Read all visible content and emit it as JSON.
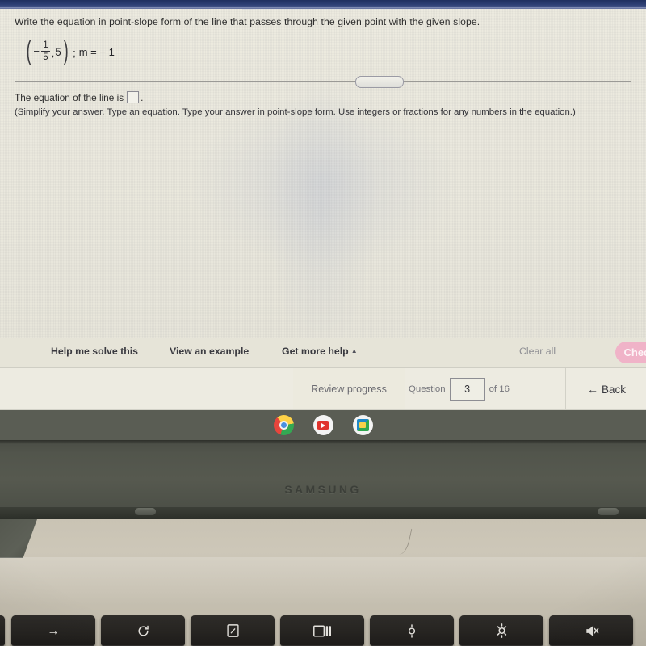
{
  "screen": {
    "problem": {
      "prompt": "Write the equation in point-slope form of the line that passes through the given point with the given slope.",
      "expression": {
        "x_sign": "−",
        "x_num": "1",
        "x_den": "5",
        "separator": ",",
        "y_value": "5",
        "semicolon": ";",
        "slope": "m = − 1"
      },
      "answer_line": "The equation of the line is",
      "answer_suffix": ".",
      "instruction": "(Simplify your answer. Type an equation. Type your answer in point-slope form. Use integers or fractions for any numbers in the equation.)"
    },
    "help_row": {
      "help_me_solve": "Help me solve this",
      "view_example": "View an example",
      "get_more_help": "Get more help",
      "get_more_help_caret": "▲",
      "clear_all": "Clear all",
      "check_button": "Check"
    },
    "nav_bar": {
      "review_progress": "Review progress",
      "question_label": "Question",
      "question_value": "3",
      "question_of": "of 16",
      "back_arrow": "←",
      "back_label": "Back"
    },
    "shelf": {
      "apps": [
        {
          "name": "chrome-icon",
          "label": "Chrome"
        },
        {
          "name": "youtube-icon",
          "label": "YouTube"
        },
        {
          "name": "classroom-icon",
          "label": "Google Classroom"
        }
      ]
    }
  },
  "laptop": {
    "brand": "SAMSUNG",
    "keys": [
      {
        "name": "forward-key",
        "glyph": "→",
        "label": "Forward"
      },
      {
        "name": "reload-key",
        "glyph": "⟳",
        "label": "Reload"
      },
      {
        "name": "fullscreen-key",
        "glyph": "",
        "label": "Fullscreen"
      },
      {
        "name": "overview-key",
        "glyph": "",
        "label": "Show windows"
      },
      {
        "name": "brightness-down-key",
        "glyph": "",
        "label": "Brightness down"
      },
      {
        "name": "brightness-up-key",
        "glyph": "",
        "label": "Brightness up"
      },
      {
        "name": "mute-key",
        "glyph": "",
        "label": "Mute"
      }
    ]
  },
  "colors": {
    "screen_bg": "#eceadf",
    "titlebar_blue": "#2b3d72",
    "shelf": "#5a5d54",
    "check_button_pink": "#f0b3c8",
    "bezel": "#56594f",
    "deck": "#c9c3b4"
  }
}
